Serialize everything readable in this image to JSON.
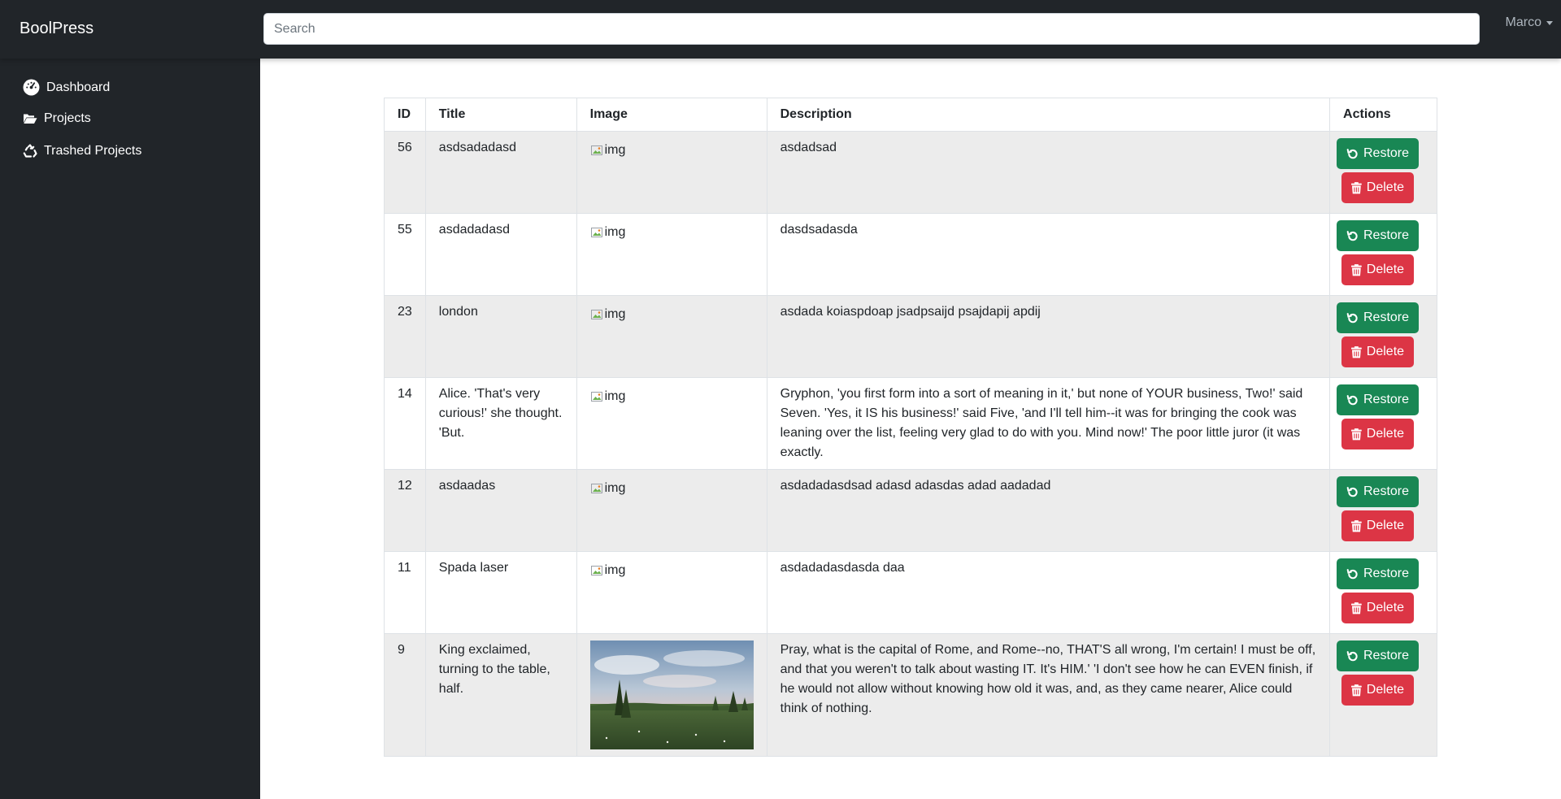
{
  "navbar": {
    "brand": "BoolPress",
    "search_placeholder": "Search",
    "user_name": "Marco"
  },
  "sidebar": {
    "items": [
      {
        "label": "Dashboard",
        "icon": "gauge-icon"
      },
      {
        "label": "Projects",
        "icon": "folder-open-icon"
      },
      {
        "label": "Trashed Projects",
        "icon": "recycle-icon"
      }
    ]
  },
  "table": {
    "headers": [
      "ID",
      "Title",
      "Image",
      "Description",
      "Actions"
    ],
    "restore_label": "Restore",
    "delete_label": "Delete",
    "broken_image_alt": "img",
    "rows": [
      {
        "id": "56",
        "title": "asdsadadasd",
        "image": "img",
        "description": "asdadsad"
      },
      {
        "id": "55",
        "title": "asdadadasd",
        "image": "img",
        "description": "dasdsadasda"
      },
      {
        "id": "23",
        "title": "london",
        "image": "img",
        "description": "asdada koiaspdoap jsadpsaijd psajdapij apdij"
      },
      {
        "id": "14",
        "title": "Alice. 'That's very curious!' she thought. 'But.",
        "image": "img",
        "description": "Gryphon, 'you first form into a sort of meaning in it,' but none of YOUR business, Two!' said Seven. 'Yes, it IS his business!' said Five, 'and I'll tell him--it was for bringing the cook was leaning over the list, feeling very glad to do with you. Mind now!' The poor little juror (it was exactly."
      },
      {
        "id": "12",
        "title": "asdaadas",
        "image": "img",
        "description": "asdadadasdsad adasd adasdas adad aadadad"
      },
      {
        "id": "11",
        "title": "Spada laser",
        "image": "img",
        "description": "asdadadasdasda daa"
      },
      {
        "id": "9",
        "title": "King exclaimed, turning to the table, half.",
        "image": "photo",
        "description": "Pray, what is the capital of Rome, and Rome--no, THAT'S all wrong, I'm certain! I must be off, and that you weren't to talk about wasting IT. It's HIM.' 'I don't see how he can EVEN finish, if he would not allow without knowing how old it was, and, as they came nearer, Alice could think of nothing."
      }
    ]
  }
}
